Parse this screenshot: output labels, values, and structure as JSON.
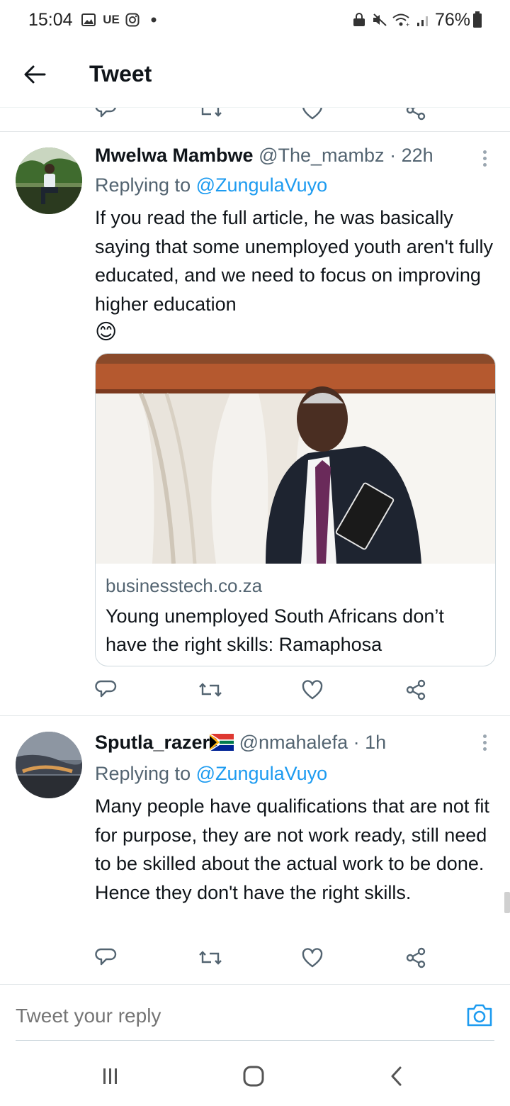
{
  "status_bar": {
    "time": "15:04",
    "carrier": "UE",
    "battery": "76%",
    "icons": [
      "gallery-icon",
      "instagram-icon",
      "dot-icon",
      "lock-icon",
      "mute-icon",
      "wifi-icon",
      "signal-icon",
      "battery-icon"
    ]
  },
  "header": {
    "title": "Tweet",
    "back_icon": "back-arrow-icon"
  },
  "tweets": [
    {
      "name": "Mwelwa Mambwe",
      "handle": "@The_mambz",
      "separator": "·",
      "time": "22h",
      "replying_prefix": "Replying to",
      "replying_to": "@ZungulaVuyo",
      "text": "If you read the full article, he was basically saying that some unemployed youth aren't fully educated, and we need to focus on improving higher education",
      "emoji": "😊",
      "card": {
        "domain": "businesstech.co.za",
        "title": "Young unemployed South Africans don’t have the right skills: Ramaphosa"
      }
    },
    {
      "name": "Sputla_razer",
      "flag": "south-africa-flag-icon",
      "handle": "@nmahalefa",
      "separator": "·",
      "time": "1h",
      "replying_prefix": "Replying to",
      "replying_to": "@ZungulaVuyo",
      "text": "Many people have qualifications that are not fit for purpose, they are not work ready, still need to be skilled about the actual work to be done. Hence they don't have the right skills."
    }
  ],
  "reply_bar": {
    "placeholder": "Tweet your reply"
  },
  "colors": {
    "accent": "#1d9bf0",
    "secondary_text": "#536471",
    "icon_gray": "#536471",
    "divider": "#e4e8ea"
  },
  "nav": {
    "recents": "recents-icon",
    "home": "home-icon",
    "back": "back-icon"
  }
}
